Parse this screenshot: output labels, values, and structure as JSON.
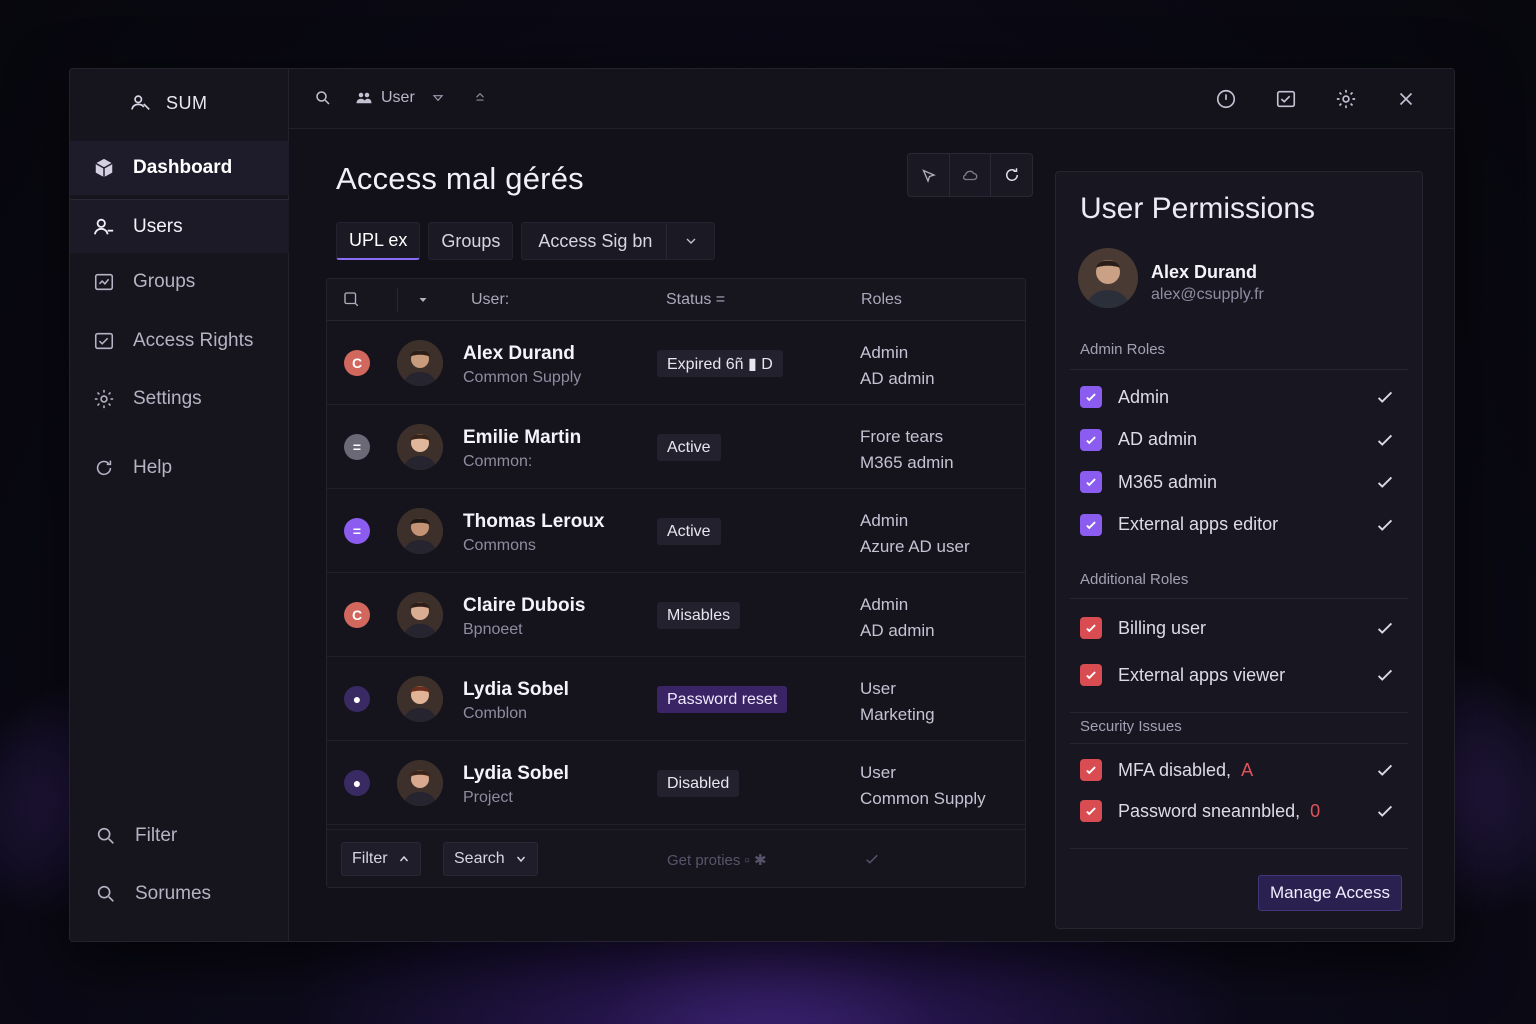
{
  "app": {
    "name": "SUM"
  },
  "sidebar": {
    "items": [
      {
        "label": "Dashboard",
        "icon": "cube-icon",
        "active": true
      },
      {
        "label": "Users",
        "icon": "user-icon",
        "active": false
      },
      {
        "label": "Groups",
        "icon": "groups-icon",
        "active": false
      },
      {
        "label": "Access Rights",
        "icon": "access-rights-icon",
        "active": false
      },
      {
        "label": "Settings",
        "icon": "gear-icon",
        "active": false
      },
      {
        "label": "Help",
        "icon": "help-icon",
        "active": false
      }
    ],
    "bottom": [
      {
        "label": "Filter",
        "icon": "search-icon"
      },
      {
        "label": "Sorumes",
        "icon": "search-icon"
      }
    ]
  },
  "topbar": {
    "user_label": "User"
  },
  "main": {
    "title": "Access mal gérés",
    "tabs": [
      {
        "label": "UPL ex",
        "active": true
      },
      {
        "label": "Groups",
        "active": false
      },
      {
        "label": "Access Sig bn",
        "active": false,
        "dropdown": true
      }
    ],
    "table": {
      "headers": {
        "user": "User:",
        "status": "Status =",
        "roles": "Roles"
      },
      "rows": [
        {
          "dot": "C",
          "dot_color": "#d2675d",
          "name": "Alex Durand",
          "sub": "Common Supply",
          "status": "Expired 6ñ ▮ D",
          "status_style": "default",
          "role1": "Admin",
          "role2": "AD admin"
        },
        {
          "dot": "=",
          "dot_color": "#6b6877",
          "name": "Emilie Martin",
          "sub": "Common:",
          "status": "Active",
          "status_style": "default",
          "role1": "Frore tears",
          "role2": "M365 admin"
        },
        {
          "dot": "=",
          "dot_color": "#8c5cf0",
          "name": "Thomas Leroux",
          "sub": "Commons",
          "status": "Active",
          "status_style": "default",
          "role1": "Admin",
          "role2": "Azure AD user"
        },
        {
          "dot": "C",
          "dot_color": "#d2675d",
          "name": "Claire Dubois",
          "sub": "Bpnoeet",
          "status": "Misables",
          "status_style": "default",
          "role1": "Admin",
          "role2": "AD admin"
        },
        {
          "dot": "●",
          "dot_color": "#3a2a64",
          "name": "Lydia Sobel",
          "sub": "Comblon",
          "status": "Password reset",
          "status_style": "purple",
          "role1": "User",
          "role2": "Marketing"
        },
        {
          "dot": "●",
          "dot_color": "#3a2a64",
          "name": "Lydia Sobel",
          "sub": "Project",
          "status": "Disabled",
          "status_style": "default",
          "role1": "User",
          "role2": "Common Supply"
        }
      ],
      "footer": {
        "filter_label": "Filter",
        "search_label": "Search",
        "hint": "Get proties ▫ ✱"
      }
    }
  },
  "permissions": {
    "title": "User Permissions",
    "user": {
      "name": "Alex Durand",
      "email": "alex@csupply.fr"
    },
    "admin_roles_label": "Admin Roles",
    "admin_roles": [
      "Admin",
      "AD admin",
      "M365 admin",
      "External apps editor"
    ],
    "additional_roles_label": "Additional Roles",
    "additional_roles": [
      "Billing user",
      "External apps viewer"
    ],
    "security_label": "Security Issues",
    "security": [
      {
        "label": "MFA disabled,",
        "count": "A"
      },
      {
        "label": "Password sneannbled,",
        "count": "0"
      }
    ],
    "manage_button": "Manage Access"
  },
  "colors": {
    "accent": "#8a5cf0",
    "danger": "#d94d52",
    "background": "#121119"
  }
}
